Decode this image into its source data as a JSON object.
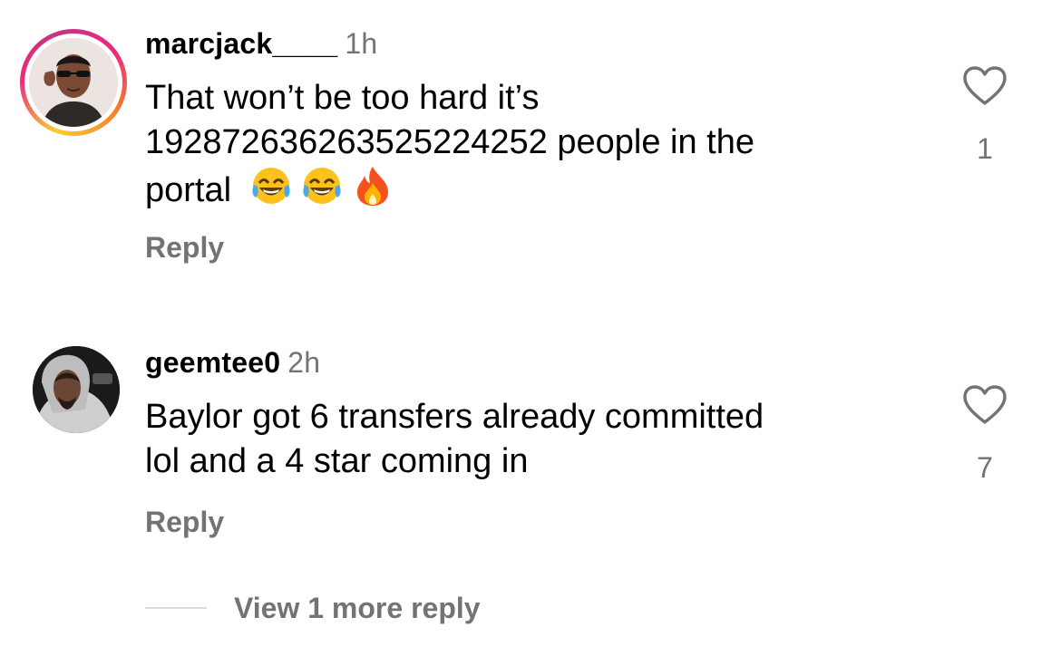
{
  "comments": [
    {
      "username": "marcjack____",
      "time": "1h",
      "text_lines": [
        "That won’t be too hard it’s",
        "19287263626352522425​2 people in the",
        "portal"
      ],
      "emojis": [
        "😂",
        "😂",
        "🔥"
      ],
      "reply_label": "Reply",
      "likes": "1",
      "story_ring": true
    },
    {
      "username": "geemtee0",
      "time": "2h",
      "text_lines": [
        "Baylor got 6 transfers already committed",
        "lol and a 4 star coming in"
      ],
      "reply_label": "Reply",
      "likes": "7",
      "story_ring": false
    }
  ],
  "view_more_label": "View 1 more reply",
  "colors": {
    "secondary_text": "#737373",
    "divider": "#dbdbdb",
    "story_ring": [
      "#f9ce34",
      "#ee2a7b",
      "#c13584",
      "#f58529"
    ]
  }
}
